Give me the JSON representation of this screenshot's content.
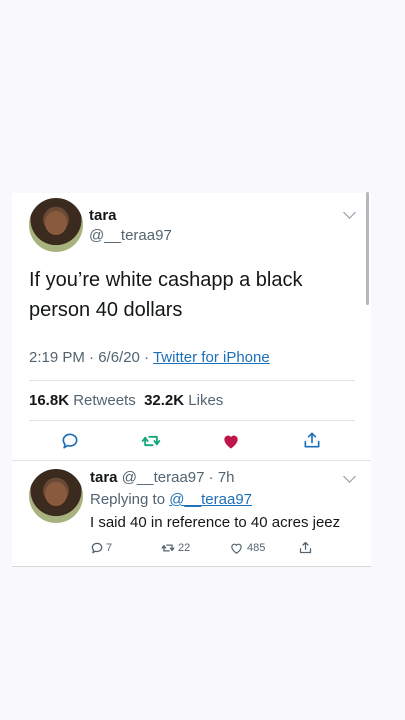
{
  "tweet": {
    "name": "tara",
    "handle": "@__teraa97",
    "text": "If you’re white cashapp a black person 40 dollars",
    "time": "2:19 PM · 6/6/20 · ",
    "source": "Twitter for iPhone",
    "retweets_count": "16.8K",
    "retweets_label": " Retweets",
    "likes_count": "32.2K",
    "likes_label": " Likes"
  },
  "reply": {
    "name": "tara",
    "handle_time": " @__teraa97 · 7h",
    "replying_prefix": "Replying to ",
    "replying_handle": "@__teraa97",
    "text": "I said 40 in reference to 40 acres jeez",
    "reply_count": "7",
    "retweet_count": "22",
    "like_count": "485"
  },
  "colors": {
    "link": "#1d6fb8",
    "like_active": "#c0154a",
    "retweet": "#17a67a",
    "icon": "#1d6fb8"
  },
  "icons": [
    "chevron-down-icon",
    "reply-icon",
    "retweet-icon",
    "heart-icon",
    "share-icon"
  ]
}
